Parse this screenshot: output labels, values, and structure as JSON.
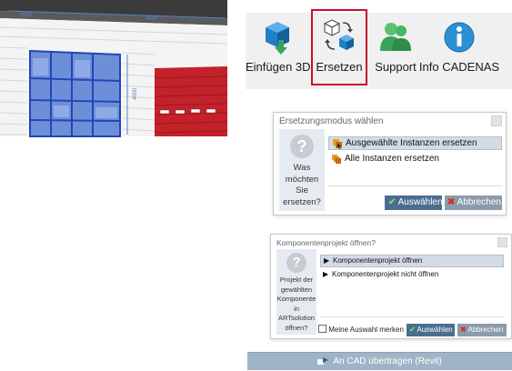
{
  "model": {
    "dimension_top_left": "4000",
    "dimension_top_right": "4000",
    "dimension_side": "4000"
  },
  "ribbon": {
    "buttons": [
      {
        "label": "Einfügen 3D",
        "icon": "insert-3d-icon",
        "color": "#1e7fc4"
      },
      {
        "label": "Ersetzen",
        "icon": "replace-icon",
        "color": "#1e7fc4",
        "highlight_color": "#c8102e"
      },
      {
        "label": "Support",
        "icon": "support-icon",
        "color": "#3aa35a"
      },
      {
        "label": "Info CADENAS",
        "icon": "info-icon",
        "color": "#2b8fd6"
      }
    ]
  },
  "dialog_replace": {
    "title": "Ersetzungsmodus wählen",
    "question_line1": "Was",
    "question_line2": "möchten",
    "question_line3": "Sie",
    "question_line4": "ersetzen?",
    "options": [
      {
        "label": "Ausgewählte Instanzen ersetzen",
        "selected": true
      },
      {
        "label": "Alle Instanzen ersetzen",
        "selected": false
      }
    ],
    "ok_label": "Auswählen",
    "cancel_label": "Abbrechen"
  },
  "dialog_open": {
    "title": "Komponentenprojekt öffnen?",
    "question_line1": "Projekt der",
    "question_line2": "gewählten",
    "question_line3": "Komponente",
    "question_line4": "in",
    "question_line5": "ARTsolution",
    "question_line6": "öffnen?",
    "options": [
      {
        "label": "Komponentenprojekt öffnen",
        "selected": true
      },
      {
        "label": "Komponentenprojekt nicht öffnen",
        "selected": false
      }
    ],
    "remember_label": "Meine Auswahl merken",
    "remember_checked": false,
    "ok_label": "Auswählen",
    "cancel_label": "Abbrechen"
  },
  "transfer_button": {
    "label": "An CAD übertragen (Revit)",
    "icon": "cad-transfer-icon"
  }
}
